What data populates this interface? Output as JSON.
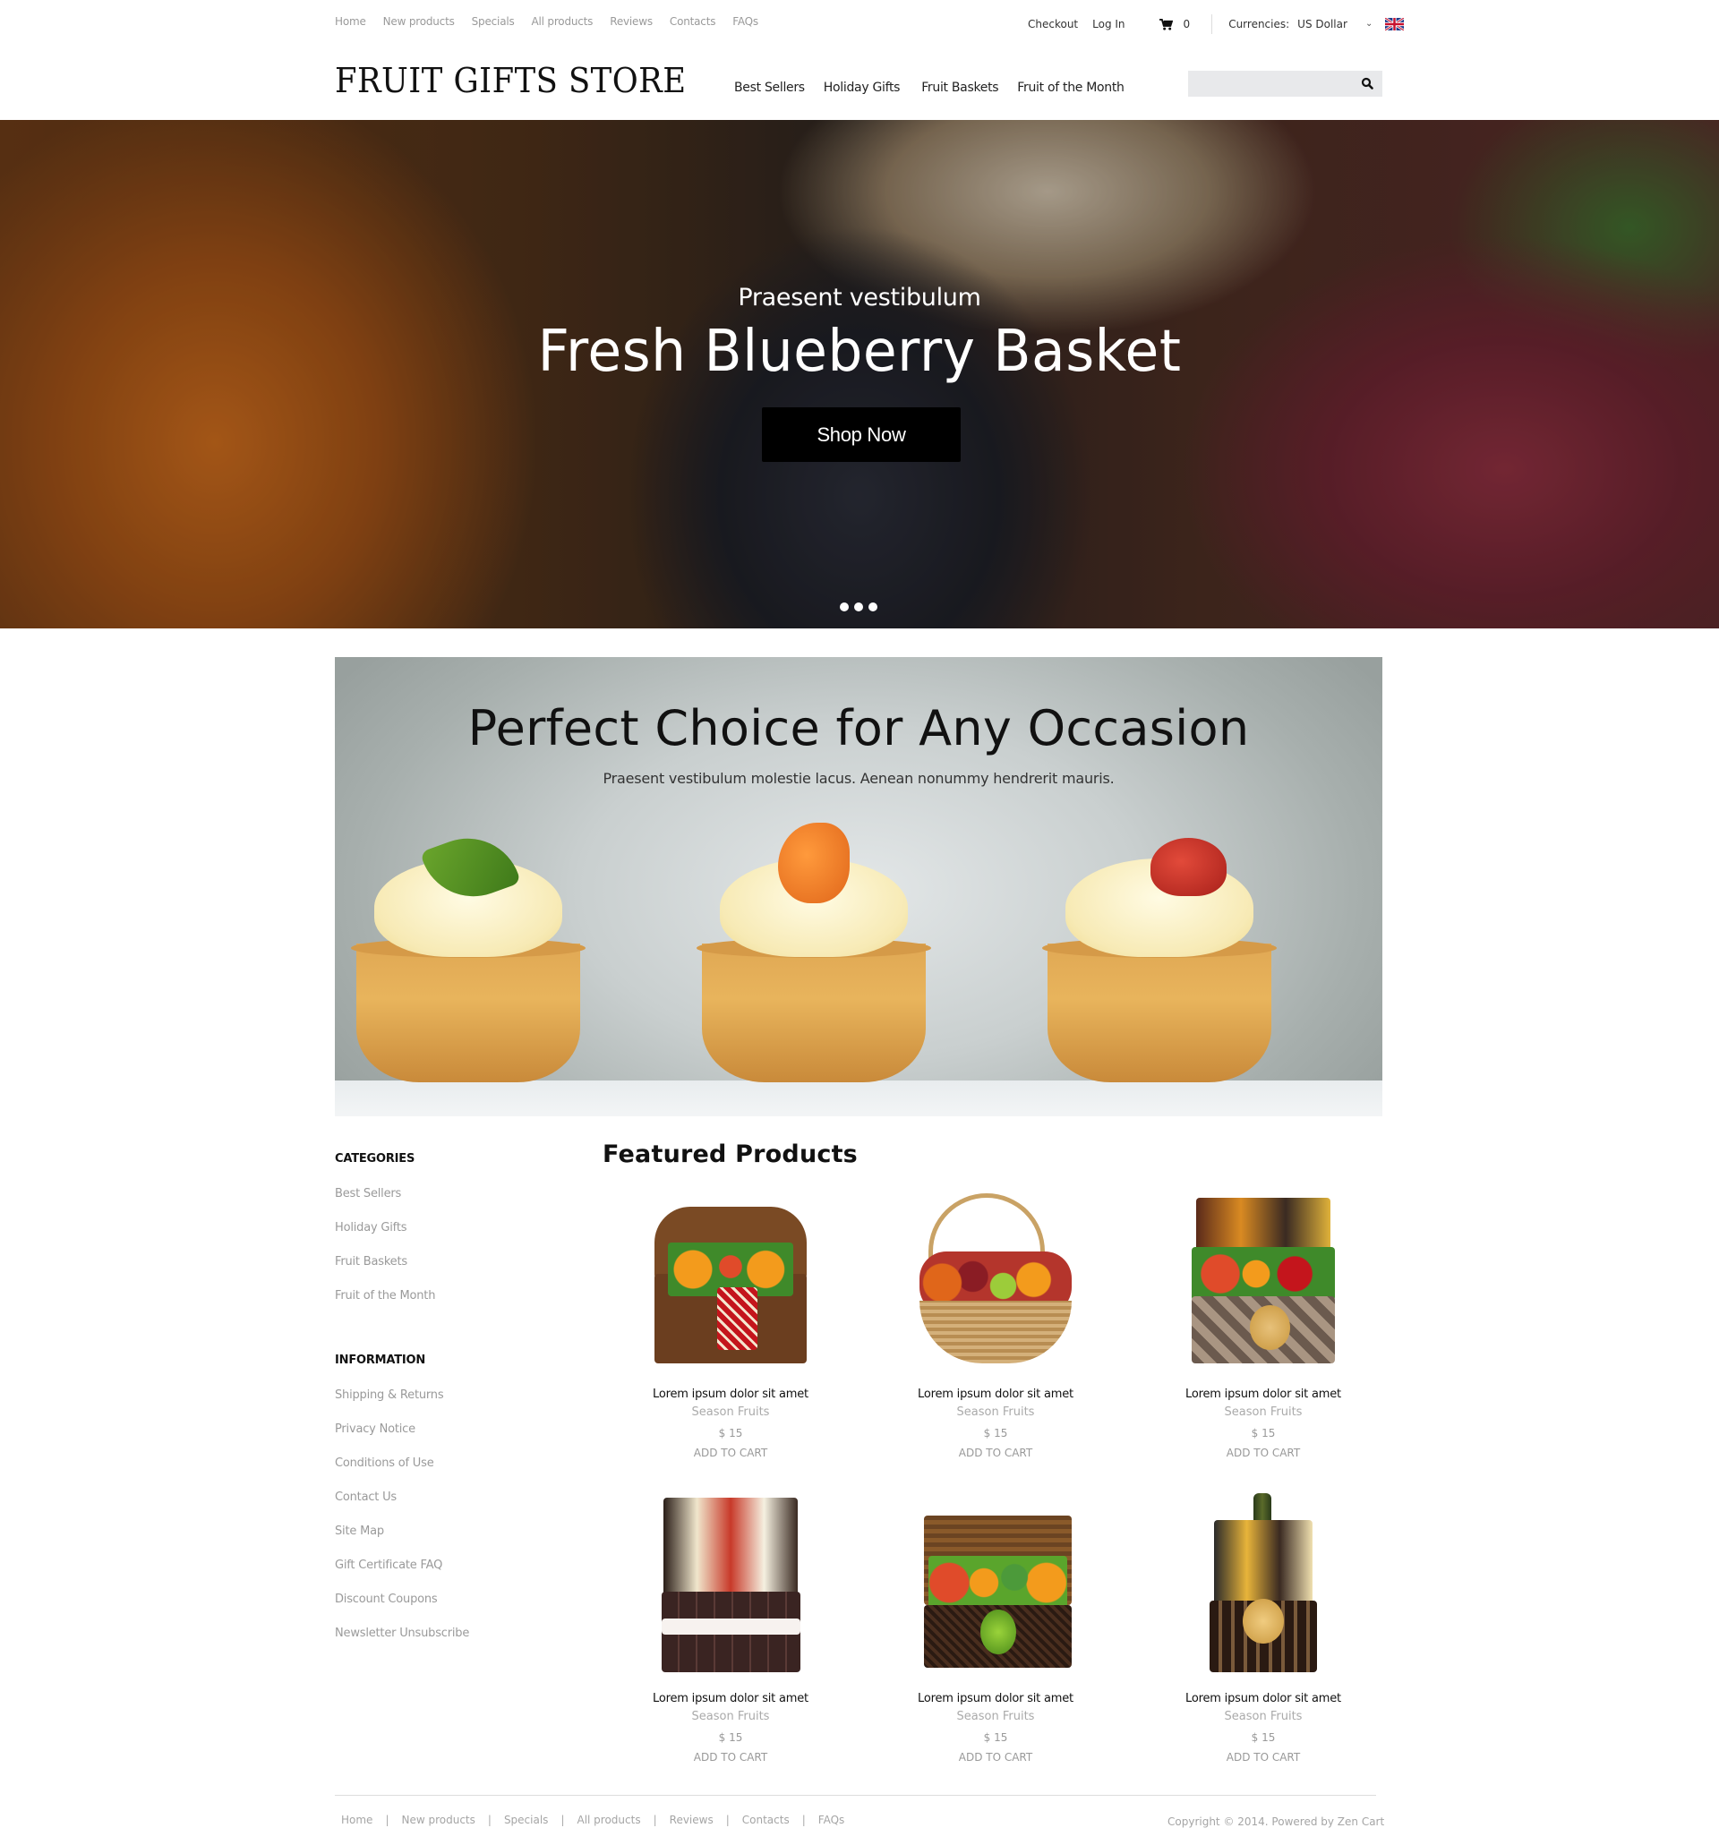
{
  "topbar": {
    "nav": [
      "Home",
      "New products",
      "Specials",
      "All products",
      "Reviews",
      "Contacts",
      "FAQs"
    ],
    "checkout": "Checkout",
    "login": "Log In",
    "cart_icon": "shopping-cart-icon",
    "cart_count": "0",
    "currency_label": "Currencies:",
    "currency_value": "US Dollar",
    "language_flag": "uk-flag-icon"
  },
  "header": {
    "logo": "FRUIT GIFTS STORE",
    "nav": [
      "Best Sellers",
      "Holiday Gifts",
      "Fruit Baskets",
      "Fruit of the Month"
    ],
    "search_placeholder": "",
    "search_icon": "search-icon"
  },
  "hero": {
    "subtitle": "Praesent vestibulum",
    "title": "Fresh Blueberry Basket",
    "button": "Shop Now",
    "slides": 3,
    "active_slide": 1
  },
  "banner": {
    "title": "Perfect Choice for Any Occasion",
    "subtitle": "Praesent vestibulum molestie lacus. Aenean nonummy hendrerit mauris."
  },
  "sidebar": {
    "categories_heading": "CATEGORIES",
    "categories": [
      "Best Sellers",
      "Holiday Gifts",
      "Fruit Baskets",
      "Fruit of the Month"
    ],
    "information_heading": "INFORMATION",
    "information": [
      "Shipping & Returns",
      "Privacy Notice",
      "Conditions of Use",
      "Contact Us",
      "Site Map",
      "Gift Certificate FAQ",
      "Discount Coupons",
      "Newsletter Unsubscribe"
    ]
  },
  "featured": {
    "title": "Featured Products",
    "products": [
      {
        "name": "Lorem ipsum dolor sit amet",
        "category": "Season Fruits",
        "price": "$ 15",
        "action": "ADD TO CART"
      },
      {
        "name": "Lorem ipsum dolor sit amet",
        "category": "Season Fruits",
        "price": "$ 15",
        "action": "ADD TO CART"
      },
      {
        "name": "Lorem ipsum dolor sit amet",
        "category": "Season Fruits",
        "price": "$ 15",
        "action": "ADD TO CART"
      },
      {
        "name": "Lorem ipsum dolor sit amet",
        "category": "Season Fruits",
        "price": "$ 15",
        "action": "ADD TO CART"
      },
      {
        "name": "Lorem ipsum dolor sit amet",
        "category": "Season Fruits",
        "price": "$ 15",
        "action": "ADD TO CART"
      },
      {
        "name": "Lorem ipsum dolor sit amet",
        "category": "Season Fruits",
        "price": "$ 15",
        "action": "ADD TO CART"
      }
    ]
  },
  "footer": {
    "nav": [
      "Home",
      "New products",
      "Specials",
      "All products",
      "Reviews",
      "Contacts",
      "FAQs"
    ],
    "separator": "|",
    "copyright": "Copyright © 2014. Powered by Zen Cart"
  }
}
